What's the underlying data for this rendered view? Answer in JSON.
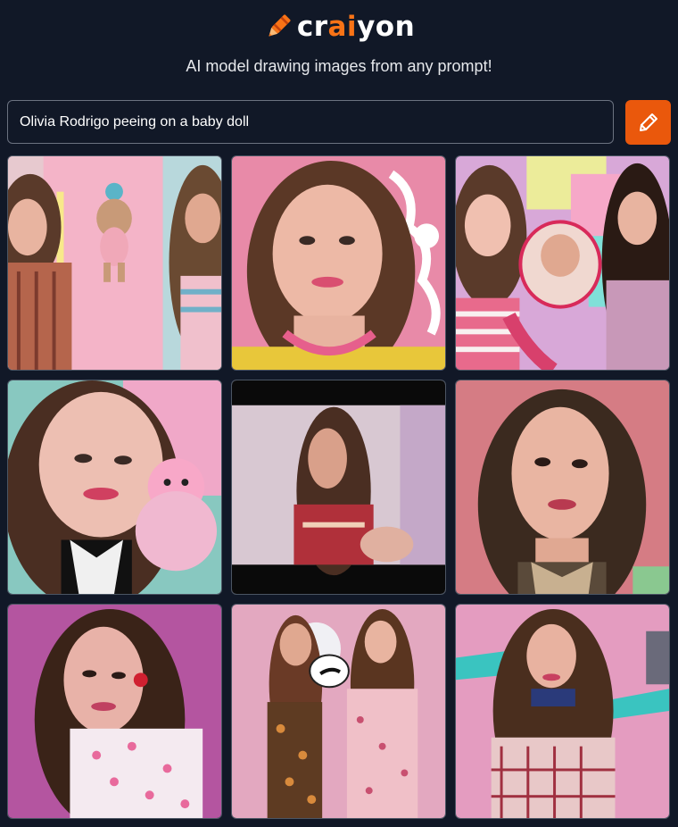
{
  "brand": {
    "name_prefix": "cr",
    "name_accent": "ai",
    "name_suffix": "yon",
    "accent_color": "#f97316",
    "icon": "crayon-icon"
  },
  "tagline": "AI model drawing images from any prompt!",
  "prompt": {
    "value": "Olivia Rodrigo peeing on a baby doll",
    "placeholder": ""
  },
  "draw_button": {
    "icon": "pencil-icon",
    "color": "#ea580c"
  },
  "results": {
    "count": 9,
    "images": [
      {
        "name": "result-image-1"
      },
      {
        "name": "result-image-2"
      },
      {
        "name": "result-image-3"
      },
      {
        "name": "result-image-4"
      },
      {
        "name": "result-image-5"
      },
      {
        "name": "result-image-6"
      },
      {
        "name": "result-image-7"
      },
      {
        "name": "result-image-8"
      },
      {
        "name": "result-image-9"
      }
    ]
  }
}
